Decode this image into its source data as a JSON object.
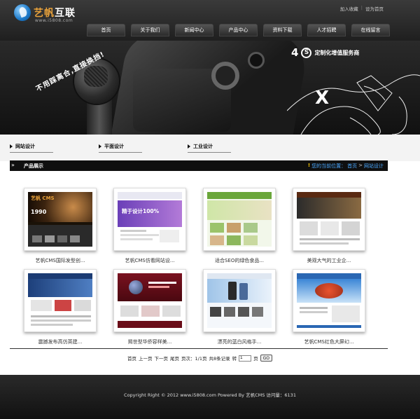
{
  "header": {
    "logo_name_accent": "艺帆",
    "logo_name_rest": "互联",
    "logo_url": "www.i5808.com",
    "top_links": [
      "加入收藏",
      "设为首页"
    ],
    "top_links_separator": "|"
  },
  "nav": {
    "items": [
      "首页",
      "关于我们",
      "新闻中心",
      "产品中心",
      "资料下载",
      "人才招聘",
      "在线留言"
    ]
  },
  "banner": {
    "slogan": "不用踩离合,直接换挡!",
    "headline_number": "4",
    "headline_letter": "S",
    "headline_text": "定制化增值服务商"
  },
  "categories": [
    "网站设计",
    "平面设计",
    "工业设计"
  ],
  "section": {
    "title": "产品展示",
    "breadcrumb_mark": "!",
    "breadcrumb_prefix": "您的当前位置：",
    "breadcrumb_home": "首页",
    "breadcrumb_sep": ">",
    "breadcrumb_current": "网站设计"
  },
  "products": [
    {
      "label": "艺帆CMS国际发型创...",
      "thumb_brand": "艺帆 CMS",
      "thumb_tagline": "1990"
    },
    {
      "label": "艺帆CMS仿看网站设...",
      "thumb_brand": "",
      "thumb_tagline": "精于设计100%"
    },
    {
      "label": "适合SEO的绿色食品...",
      "thumb_brand": "",
      "thumb_tagline": ""
    },
    {
      "label": "美观大气的工业企...",
      "thumb_brand": "",
      "thumb_tagline": ""
    },
    {
      "label": "震撼发布高仿英建...",
      "thumb_brand": "",
      "thumb_tagline": ""
    },
    {
      "label": "揭世型华侨容样美...",
      "thumb_brand": "",
      "thumb_tagline": ""
    },
    {
      "label": "漂亮的蓝白风格手...",
      "thumb_brand": "",
      "thumb_tagline": ""
    },
    {
      "label": "艺帆CMS红色大屏幻...",
      "thumb_brand": "",
      "thumb_tagline": ""
    }
  ],
  "pager": {
    "first": "首页",
    "prev": "上一页",
    "next": "下一页",
    "last": "尾页",
    "page_info": "页次：1/1页",
    "records": "共8条记录",
    "goto_label": "转",
    "goto_value": "1",
    "page_unit": "页",
    "go_button": "GO"
  },
  "footer": {
    "copyright": "Copyright Right © 2012 www.i5808.com Powered By 艺帆CMS 访问量：6131"
  },
  "colors": {
    "header_bg": "#2c2c2c",
    "breadcrumb_link": "#4aa8ff",
    "breadcrumb_mark": "#f5c400",
    "logo_accent": "#e9a23b"
  }
}
